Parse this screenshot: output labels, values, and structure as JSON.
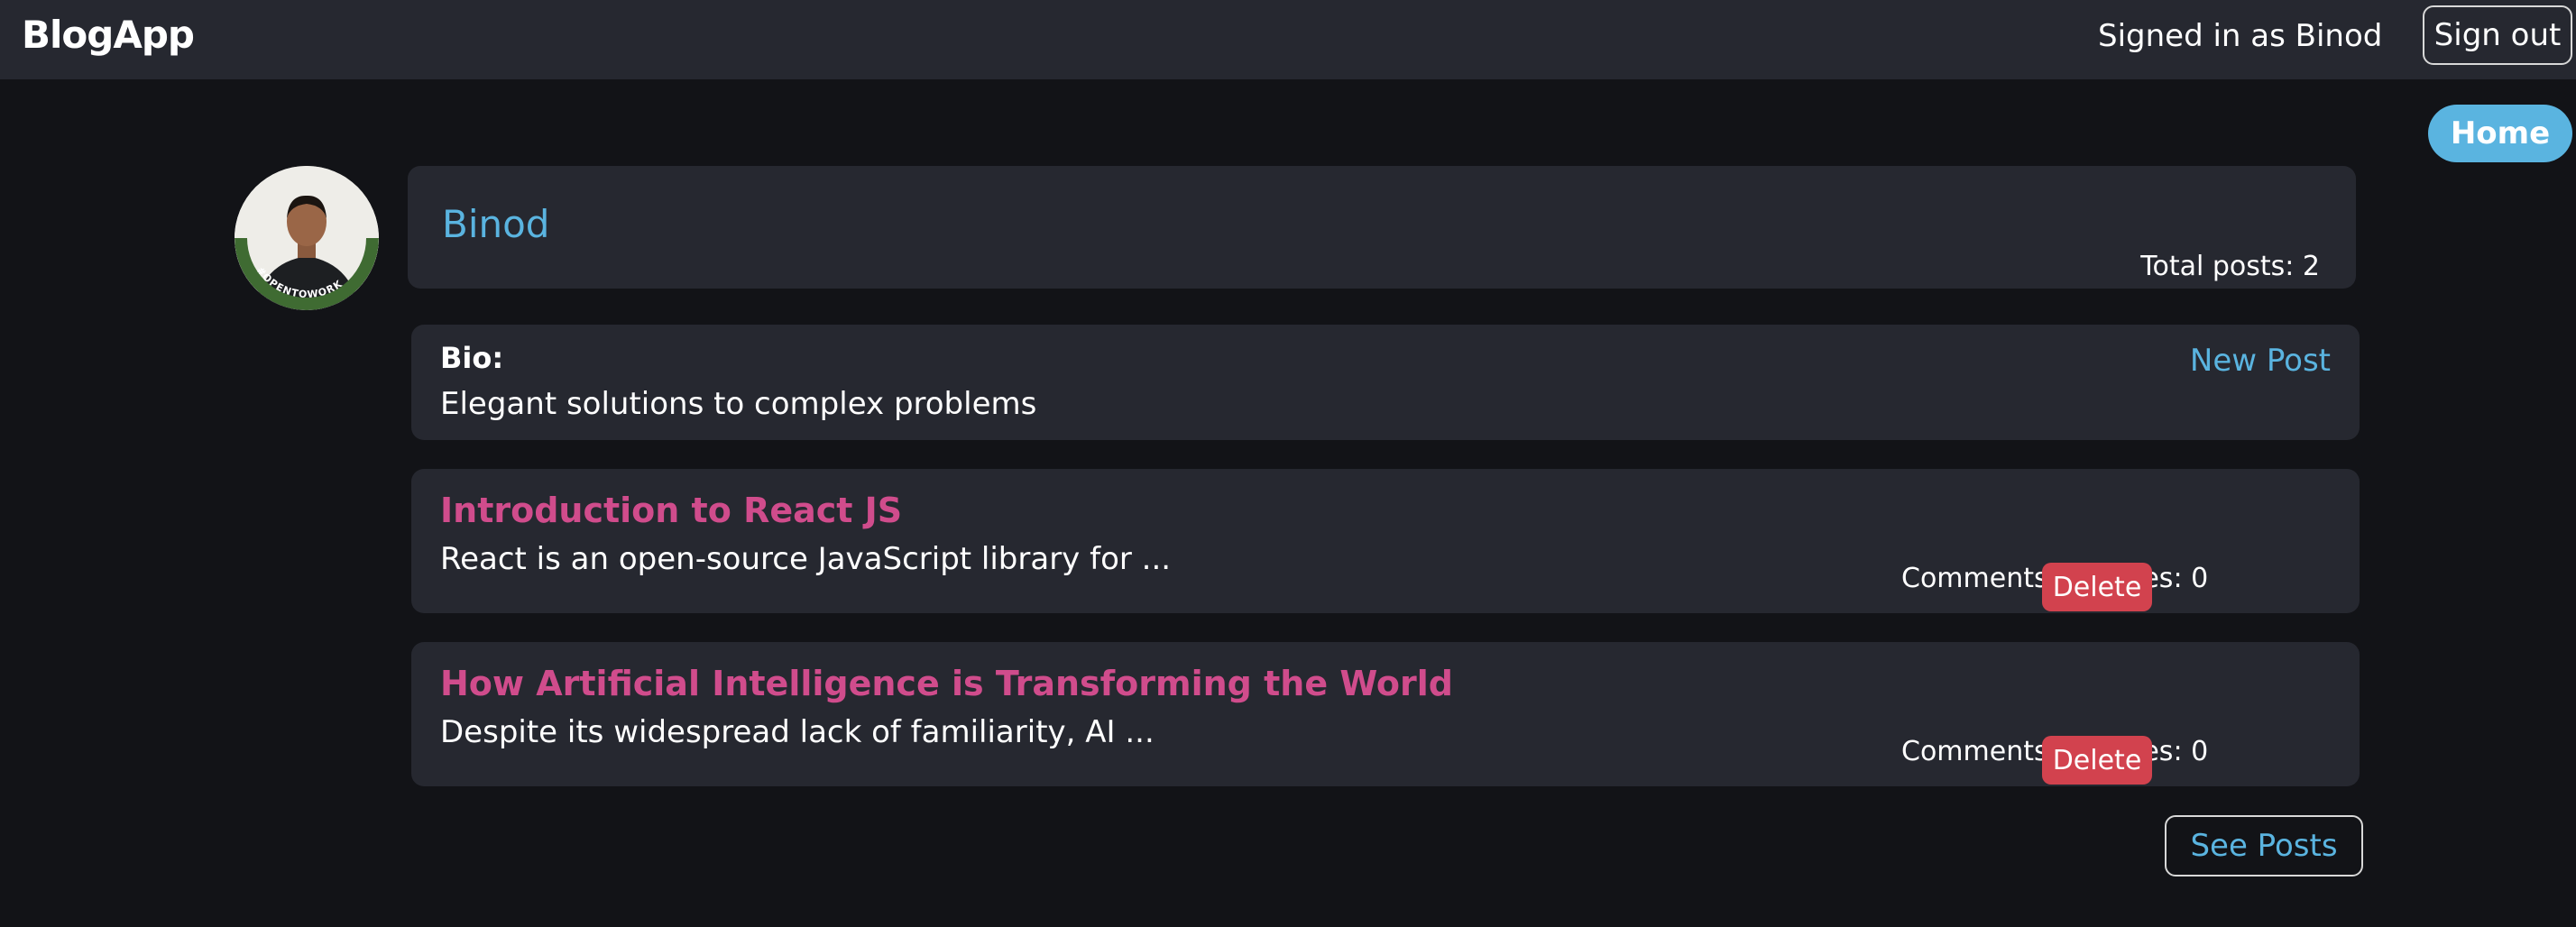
{
  "header": {
    "brand": "BlogApp",
    "signed_in_text": "Signed in as Binod",
    "sign_out_label": "Sign out"
  },
  "nav": {
    "home_label": "Home"
  },
  "profile": {
    "name": "Binod",
    "total_posts": "Total posts: 2",
    "avatar_badge_text": "#OPENTOWORK"
  },
  "bio": {
    "label": "Bio:",
    "text": "Elegant solutions to complex problems",
    "new_post_label": "New Post"
  },
  "posts": [
    {
      "title": "Introduction to React JS",
      "excerpt": "React is an open-source JavaScript library for ...",
      "comments": "Comments: 0",
      "likes": "Likes: 0",
      "delete_label": "Delete"
    },
    {
      "title": "How Artificial Intelligence is Transforming the World",
      "excerpt": "Despite its widespread lack of familiarity, AI ...",
      "comments": "Comments: 0",
      "likes": "Likes: 0",
      "delete_label": "Delete"
    }
  ],
  "footer": {
    "see_posts_label": "See Posts"
  },
  "colors": {
    "background": "#121317",
    "card": "#262830",
    "accent_blue": "#5ab4e0",
    "post_title_pink": "#d04c8c",
    "delete_red": "#d2424e",
    "opentowork_green": "#3f6b32"
  }
}
